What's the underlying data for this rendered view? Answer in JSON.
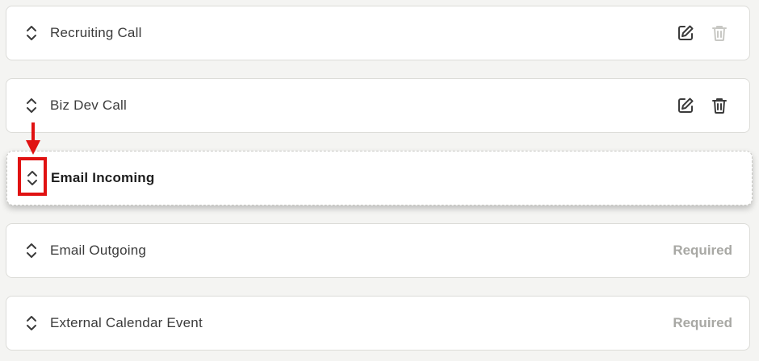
{
  "rows": [
    {
      "label": "Recruiting Call",
      "edit": "pencil-square",
      "delete": "trash-disabled"
    },
    {
      "label": "Biz Dev Call",
      "edit": "pencil-square",
      "delete": "trash"
    },
    {
      "label": "Email Incoming",
      "state": "dragging"
    },
    {
      "label": "Email Outgoing",
      "badge": "Required"
    },
    {
      "label": "External Calendar Event",
      "badge": "Required"
    }
  ],
  "annotation": {
    "color": "#e01212",
    "target": "drag-handle-icon"
  },
  "colors": {
    "disabled_icon": "#c8c8c4",
    "icon": "#3b3b3b",
    "required_text": "#a8a8a4"
  }
}
